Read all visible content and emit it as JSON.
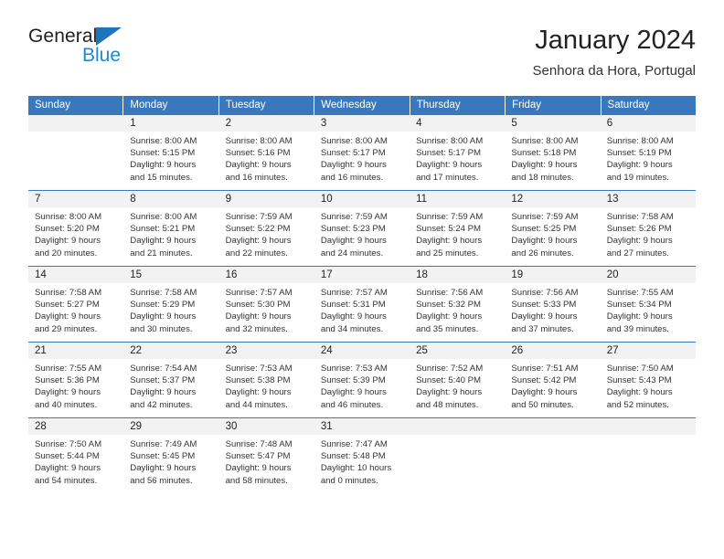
{
  "brand": {
    "name_part1": "General",
    "name_part2": "Blue",
    "triangle_color": "#1b75bb",
    "blue_color": "#1b8ad4"
  },
  "header": {
    "title": "January 2024",
    "subtitle": "Senhora da Hora, Portugal"
  },
  "theme": {
    "header_blue": "#3a78bd",
    "daynum_bg": "#f2f2f2",
    "text": "#333333"
  },
  "calendar": {
    "weekday_headers": [
      "Sunday",
      "Monday",
      "Tuesday",
      "Wednesday",
      "Thursday",
      "Friday",
      "Saturday"
    ],
    "weeks": [
      [
        {
          "day": "",
          "lines": []
        },
        {
          "day": "1",
          "lines": [
            "Sunrise: 8:00 AM",
            "Sunset: 5:15 PM",
            "Daylight: 9 hours",
            "and 15 minutes."
          ]
        },
        {
          "day": "2",
          "lines": [
            "Sunrise: 8:00 AM",
            "Sunset: 5:16 PM",
            "Daylight: 9 hours",
            "and 16 minutes."
          ]
        },
        {
          "day": "3",
          "lines": [
            "Sunrise: 8:00 AM",
            "Sunset: 5:17 PM",
            "Daylight: 9 hours",
            "and 16 minutes."
          ]
        },
        {
          "day": "4",
          "lines": [
            "Sunrise: 8:00 AM",
            "Sunset: 5:17 PM",
            "Daylight: 9 hours",
            "and 17 minutes."
          ]
        },
        {
          "day": "5",
          "lines": [
            "Sunrise: 8:00 AM",
            "Sunset: 5:18 PM",
            "Daylight: 9 hours",
            "and 18 minutes."
          ]
        },
        {
          "day": "6",
          "lines": [
            "Sunrise: 8:00 AM",
            "Sunset: 5:19 PM",
            "Daylight: 9 hours",
            "and 19 minutes."
          ]
        }
      ],
      [
        {
          "day": "7",
          "lines": [
            "Sunrise: 8:00 AM",
            "Sunset: 5:20 PM",
            "Daylight: 9 hours",
            "and 20 minutes."
          ]
        },
        {
          "day": "8",
          "lines": [
            "Sunrise: 8:00 AM",
            "Sunset: 5:21 PM",
            "Daylight: 9 hours",
            "and 21 minutes."
          ]
        },
        {
          "day": "9",
          "lines": [
            "Sunrise: 7:59 AM",
            "Sunset: 5:22 PM",
            "Daylight: 9 hours",
            "and 22 minutes."
          ]
        },
        {
          "day": "10",
          "lines": [
            "Sunrise: 7:59 AM",
            "Sunset: 5:23 PM",
            "Daylight: 9 hours",
            "and 24 minutes."
          ]
        },
        {
          "day": "11",
          "lines": [
            "Sunrise: 7:59 AM",
            "Sunset: 5:24 PM",
            "Daylight: 9 hours",
            "and 25 minutes."
          ]
        },
        {
          "day": "12",
          "lines": [
            "Sunrise: 7:59 AM",
            "Sunset: 5:25 PM",
            "Daylight: 9 hours",
            "and 26 minutes."
          ]
        },
        {
          "day": "13",
          "lines": [
            "Sunrise: 7:58 AM",
            "Sunset: 5:26 PM",
            "Daylight: 9 hours",
            "and 27 minutes."
          ]
        }
      ],
      [
        {
          "day": "14",
          "lines": [
            "Sunrise: 7:58 AM",
            "Sunset: 5:27 PM",
            "Daylight: 9 hours",
            "and 29 minutes."
          ]
        },
        {
          "day": "15",
          "lines": [
            "Sunrise: 7:58 AM",
            "Sunset: 5:29 PM",
            "Daylight: 9 hours",
            "and 30 minutes."
          ]
        },
        {
          "day": "16",
          "lines": [
            "Sunrise: 7:57 AM",
            "Sunset: 5:30 PM",
            "Daylight: 9 hours",
            "and 32 minutes."
          ]
        },
        {
          "day": "17",
          "lines": [
            "Sunrise: 7:57 AM",
            "Sunset: 5:31 PM",
            "Daylight: 9 hours",
            "and 34 minutes."
          ]
        },
        {
          "day": "18",
          "lines": [
            "Sunrise: 7:56 AM",
            "Sunset: 5:32 PM",
            "Daylight: 9 hours",
            "and 35 minutes."
          ]
        },
        {
          "day": "19",
          "lines": [
            "Sunrise: 7:56 AM",
            "Sunset: 5:33 PM",
            "Daylight: 9 hours",
            "and 37 minutes."
          ]
        },
        {
          "day": "20",
          "lines": [
            "Sunrise: 7:55 AM",
            "Sunset: 5:34 PM",
            "Daylight: 9 hours",
            "and 39 minutes."
          ]
        }
      ],
      [
        {
          "day": "21",
          "lines": [
            "Sunrise: 7:55 AM",
            "Sunset: 5:36 PM",
            "Daylight: 9 hours",
            "and 40 minutes."
          ]
        },
        {
          "day": "22",
          "lines": [
            "Sunrise: 7:54 AM",
            "Sunset: 5:37 PM",
            "Daylight: 9 hours",
            "and 42 minutes."
          ]
        },
        {
          "day": "23",
          "lines": [
            "Sunrise: 7:53 AM",
            "Sunset: 5:38 PM",
            "Daylight: 9 hours",
            "and 44 minutes."
          ]
        },
        {
          "day": "24",
          "lines": [
            "Sunrise: 7:53 AM",
            "Sunset: 5:39 PM",
            "Daylight: 9 hours",
            "and 46 minutes."
          ]
        },
        {
          "day": "25",
          "lines": [
            "Sunrise: 7:52 AM",
            "Sunset: 5:40 PM",
            "Daylight: 9 hours",
            "and 48 minutes."
          ]
        },
        {
          "day": "26",
          "lines": [
            "Sunrise: 7:51 AM",
            "Sunset: 5:42 PM",
            "Daylight: 9 hours",
            "and 50 minutes."
          ]
        },
        {
          "day": "27",
          "lines": [
            "Sunrise: 7:50 AM",
            "Sunset: 5:43 PM",
            "Daylight: 9 hours",
            "and 52 minutes."
          ]
        }
      ],
      [
        {
          "day": "28",
          "lines": [
            "Sunrise: 7:50 AM",
            "Sunset: 5:44 PM",
            "Daylight: 9 hours",
            "and 54 minutes."
          ]
        },
        {
          "day": "29",
          "lines": [
            "Sunrise: 7:49 AM",
            "Sunset: 5:45 PM",
            "Daylight: 9 hours",
            "and 56 minutes."
          ]
        },
        {
          "day": "30",
          "lines": [
            "Sunrise: 7:48 AM",
            "Sunset: 5:47 PM",
            "Daylight: 9 hours",
            "and 58 minutes."
          ]
        },
        {
          "day": "31",
          "lines": [
            "Sunrise: 7:47 AM",
            "Sunset: 5:48 PM",
            "Daylight: 10 hours",
            "and 0 minutes."
          ]
        },
        {
          "day": "",
          "lines": []
        },
        {
          "day": "",
          "lines": []
        },
        {
          "day": "",
          "lines": []
        }
      ]
    ]
  }
}
